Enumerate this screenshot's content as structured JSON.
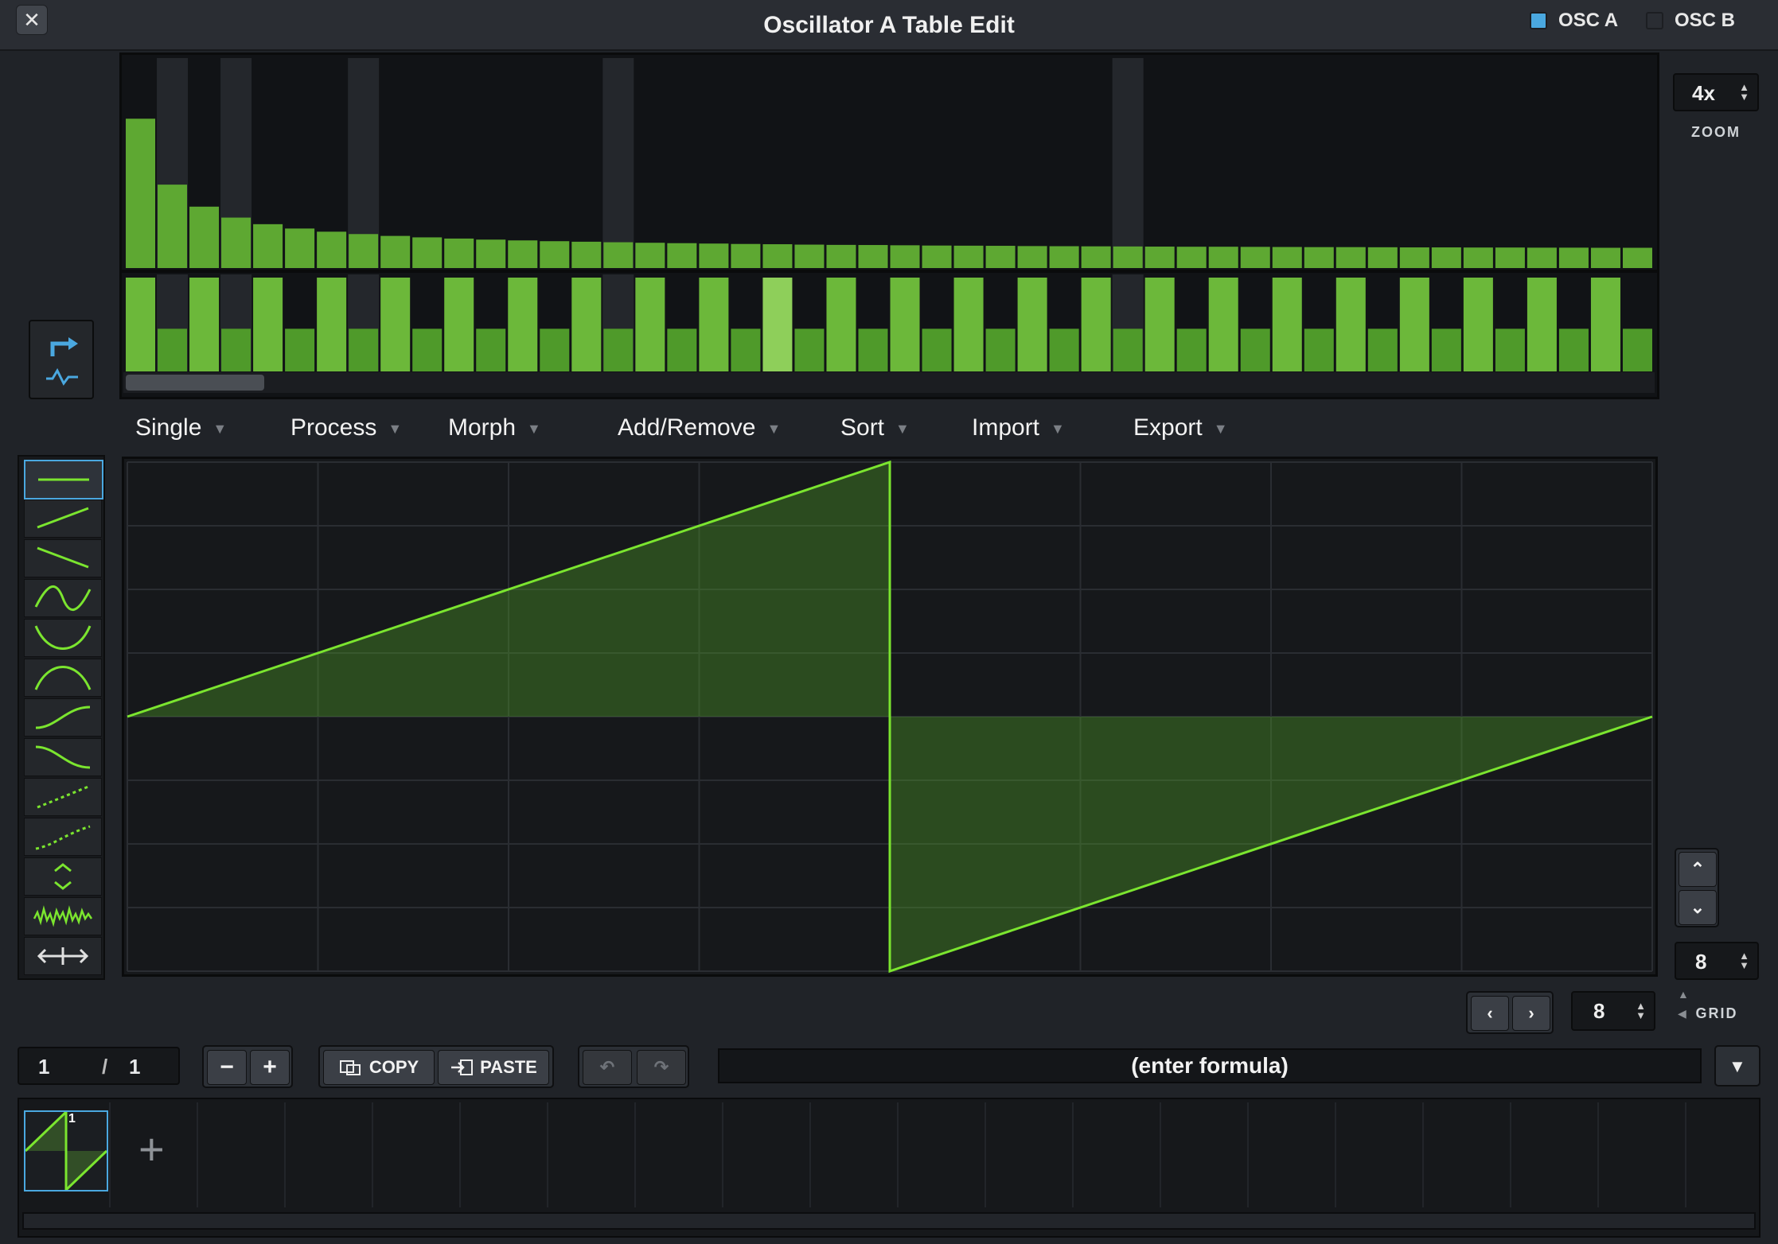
{
  "window": {
    "title": "Oscillator A Table Edit",
    "close_icon": "close-icon"
  },
  "osc_toggles": [
    {
      "label": "OSC A",
      "checked": true,
      "color": "#4aa8e0"
    },
    {
      "label": "OSC B",
      "checked": false,
      "color": "#2a2d33"
    }
  ],
  "zoom": {
    "value": "4x",
    "label": "ZOOM"
  },
  "grid": {
    "value": "8",
    "label": "GRID"
  },
  "harmonics": {
    "accent": "#5ea832",
    "selected_index": 20,
    "magnitude": [
      1.0,
      0.5,
      0.333,
      0.25,
      0.2,
      0.167,
      0.143,
      0.125,
      0.111,
      0.1,
      0.091,
      0.083,
      0.077,
      0.071,
      0.067,
      0.063,
      0.059,
      0.056,
      0.053,
      0.05,
      0.048,
      0.045,
      0.043,
      0.042,
      0.04,
      0.038,
      0.037,
      0.036,
      0.034,
      0.033,
      0.032,
      0.031,
      0.03,
      0.029,
      0.029,
      0.028,
      0.027,
      0.026,
      0.026,
      0.025,
      0.024,
      0.024,
      0.023,
      0.023,
      0.022,
      0.022,
      0.021,
      0.021
    ],
    "phase": [
      1,
      0,
      1,
      0,
      1,
      0,
      1,
      0,
      1,
      0,
      1,
      0,
      1,
      0,
      1,
      0,
      1,
      0,
      1,
      0,
      1,
      0,
      1,
      0,
      1,
      0,
      1,
      0,
      1,
      0,
      1,
      0,
      1,
      0,
      1,
      0,
      1,
      0,
      1,
      0,
      1,
      0,
      1,
      0,
      1,
      0,
      1,
      0
    ],
    "highlight_columns": [
      1,
      3,
      7,
      15,
      31
    ]
  },
  "menus": [
    {
      "label": "Single"
    },
    {
      "label": "Process"
    },
    {
      "label": "Morph"
    },
    {
      "label": "Add/Remove"
    },
    {
      "label": "Sort"
    },
    {
      "label": "Import"
    },
    {
      "label": "Export"
    }
  ],
  "tools": [
    "flat-line-icon",
    "ramp-up-icon",
    "ramp-down-icon",
    "sine-icon",
    "bowl-icon",
    "arch-icon",
    "s-curve-up-icon",
    "s-curve-down-icon",
    "dotted-ramp-icon",
    "dotted-curve-icon",
    "expand-icon",
    "noise-icon",
    "stretch-icon"
  ],
  "waveform": {
    "type": "saw",
    "points": [
      [
        0,
        0
      ],
      [
        0.5,
        1
      ],
      [
        0.5,
        -1
      ],
      [
        1,
        0
      ]
    ],
    "grid_divisions": 8,
    "color": "#7be52f"
  },
  "frame": {
    "current": "1",
    "separator": "/",
    "total": "1"
  },
  "buttons": {
    "minus": "−",
    "plus": "+",
    "copy": "COPY",
    "paste": "PASTE"
  },
  "formula": {
    "placeholder": "(enter formula)"
  },
  "frames": [
    {
      "label": "1"
    }
  ],
  "add_frame": "+"
}
